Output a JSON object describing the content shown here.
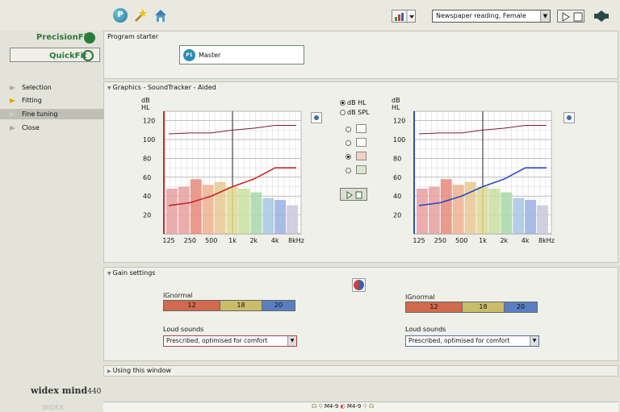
{
  "toolbar": {
    "program_value": "Newspaper reading, Female"
  },
  "sidebar": {
    "precisionfit": "PrecisionFit",
    "quickfit": "QuickFit",
    "items": [
      {
        "label": "Selection"
      },
      {
        "label": "Fitting"
      },
      {
        "label": "Fine tuning"
      },
      {
        "label": "Close"
      }
    ],
    "brand": "widex mind",
    "brand_model": "440",
    "brand_footer": "WIDEX"
  },
  "program_starter": {
    "title": "Program starter",
    "badge": "P1",
    "master_label": "Master"
  },
  "graphics": {
    "title": "Graphics - SoundTracker - Aided",
    "y_unit_top": "dB",
    "y_unit_bottom": "HL",
    "y_ticks": [
      "120",
      "100",
      "80",
      "60",
      "40",
      "20"
    ],
    "x_ticks": [
      "125",
      "250",
      "500",
      "1k",
      "2k",
      "4k",
      "8kHz"
    ],
    "radio_db_hl": "dB HL",
    "radio_db_spl": "dB SPL",
    "selected_unit": "dB HL"
  },
  "chart_data": [
    {
      "type": "line",
      "side": "left",
      "x": [
        "125",
        "250",
        "500",
        "1k",
        "2k",
        "4k",
        "8kHz"
      ],
      "ylim": [
        0,
        130
      ],
      "ylabel": "dB HL",
      "series": [
        {
          "values": [
            106,
            107,
            107,
            110,
            112,
            115,
            115
          ]
        },
        {
          "values": [
            30,
            33,
            40,
            50,
            58,
            70,
            70
          ]
        }
      ],
      "bars": [
        48,
        50,
        58,
        52,
        55,
        50,
        48,
        44,
        38,
        36,
        30
      ],
      "color": "#c62828"
    },
    {
      "type": "line",
      "side": "right",
      "x": [
        "125",
        "250",
        "500",
        "1k",
        "2k",
        "4k",
        "8kHz"
      ],
      "ylim": [
        0,
        130
      ],
      "ylabel": "dB HL",
      "series": [
        {
          "values": [
            106,
            107,
            107,
            110,
            112,
            115,
            115
          ]
        },
        {
          "values": [
            30,
            33,
            40,
            50,
            58,
            70,
            70
          ]
        }
      ],
      "bars": [
        48,
        50,
        58,
        52,
        55,
        50,
        48,
        44,
        38,
        36,
        30
      ],
      "color": "#2a4cc4"
    }
  ],
  "gain": {
    "title": "Gain settings",
    "left": {
      "ig_label": "IGnormal",
      "ig_values": [
        "12",
        "18",
        "20"
      ],
      "loud_label": "Loud sounds",
      "loud_value": "Prescribed, optimised for comfort"
    },
    "right": {
      "ig_label": "IGnormal",
      "ig_values": [
        "12",
        "18",
        "20"
      ],
      "loud_label": "Loud sounds",
      "loud_value": "Prescribed, optimised for comfort"
    },
    "colors": [
      "#d16a4e",
      "#c9bd6a",
      "#5a7fc0"
    ]
  },
  "using": {
    "title": "Using this window"
  },
  "statusbar": {
    "left_model": "M4-9",
    "right_model": "M4-9"
  }
}
